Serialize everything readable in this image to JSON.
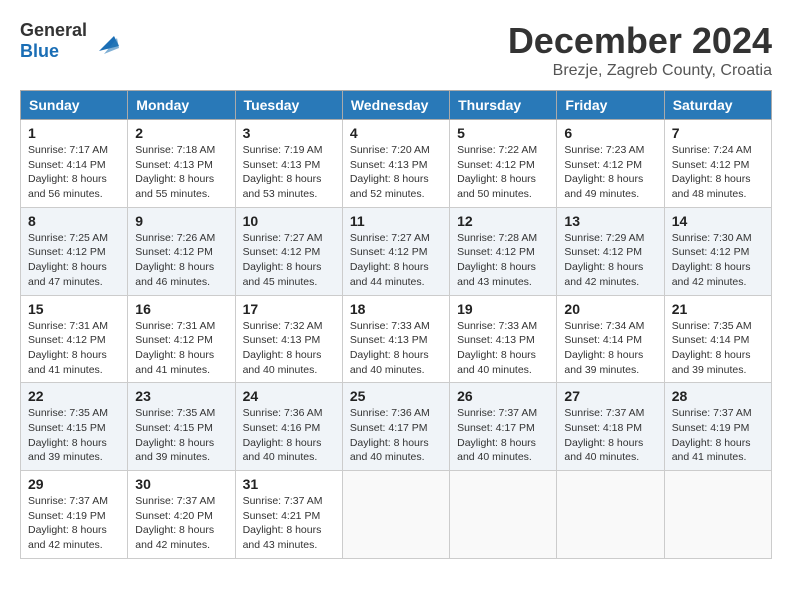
{
  "header": {
    "logo_general": "General",
    "logo_blue": "Blue",
    "month_title": "December 2024",
    "location": "Brezje, Zagreb County, Croatia"
  },
  "weekdays": [
    "Sunday",
    "Monday",
    "Tuesday",
    "Wednesday",
    "Thursday",
    "Friday",
    "Saturday"
  ],
  "days": [
    null,
    null,
    null,
    {
      "num": "1",
      "sunrise": "Sunrise: 7:17 AM",
      "sunset": "Sunset: 4:14 PM",
      "daylight": "Daylight: 8 hours and 56 minutes."
    },
    {
      "num": "2",
      "sunrise": "Sunrise: 7:18 AM",
      "sunset": "Sunset: 4:13 PM",
      "daylight": "Daylight: 8 hours and 55 minutes."
    },
    {
      "num": "3",
      "sunrise": "Sunrise: 7:19 AM",
      "sunset": "Sunset: 4:13 PM",
      "daylight": "Daylight: 8 hours and 53 minutes."
    },
    {
      "num": "4",
      "sunrise": "Sunrise: 7:20 AM",
      "sunset": "Sunset: 4:13 PM",
      "daylight": "Daylight: 8 hours and 52 minutes."
    },
    {
      "num": "5",
      "sunrise": "Sunrise: 7:22 AM",
      "sunset": "Sunset: 4:12 PM",
      "daylight": "Daylight: 8 hours and 50 minutes."
    },
    {
      "num": "6",
      "sunrise": "Sunrise: 7:23 AM",
      "sunset": "Sunset: 4:12 PM",
      "daylight": "Daylight: 8 hours and 49 minutes."
    },
    {
      "num": "7",
      "sunrise": "Sunrise: 7:24 AM",
      "sunset": "Sunset: 4:12 PM",
      "daylight": "Daylight: 8 hours and 48 minutes."
    },
    {
      "num": "8",
      "sunrise": "Sunrise: 7:25 AM",
      "sunset": "Sunset: 4:12 PM",
      "daylight": "Daylight: 8 hours and 47 minutes."
    },
    {
      "num": "9",
      "sunrise": "Sunrise: 7:26 AM",
      "sunset": "Sunset: 4:12 PM",
      "daylight": "Daylight: 8 hours and 46 minutes."
    },
    {
      "num": "10",
      "sunrise": "Sunrise: 7:27 AM",
      "sunset": "Sunset: 4:12 PM",
      "daylight": "Daylight: 8 hours and 45 minutes."
    },
    {
      "num": "11",
      "sunrise": "Sunrise: 7:27 AM",
      "sunset": "Sunset: 4:12 PM",
      "daylight": "Daylight: 8 hours and 44 minutes."
    },
    {
      "num": "12",
      "sunrise": "Sunrise: 7:28 AM",
      "sunset": "Sunset: 4:12 PM",
      "daylight": "Daylight: 8 hours and 43 minutes."
    },
    {
      "num": "13",
      "sunrise": "Sunrise: 7:29 AM",
      "sunset": "Sunset: 4:12 PM",
      "daylight": "Daylight: 8 hours and 42 minutes."
    },
    {
      "num": "14",
      "sunrise": "Sunrise: 7:30 AM",
      "sunset": "Sunset: 4:12 PM",
      "daylight": "Daylight: 8 hours and 42 minutes."
    },
    {
      "num": "15",
      "sunrise": "Sunrise: 7:31 AM",
      "sunset": "Sunset: 4:12 PM",
      "daylight": "Daylight: 8 hours and 41 minutes."
    },
    {
      "num": "16",
      "sunrise": "Sunrise: 7:31 AM",
      "sunset": "Sunset: 4:12 PM",
      "daylight": "Daylight: 8 hours and 41 minutes."
    },
    {
      "num": "17",
      "sunrise": "Sunrise: 7:32 AM",
      "sunset": "Sunset: 4:13 PM",
      "daylight": "Daylight: 8 hours and 40 minutes."
    },
    {
      "num": "18",
      "sunrise": "Sunrise: 7:33 AM",
      "sunset": "Sunset: 4:13 PM",
      "daylight": "Daylight: 8 hours and 40 minutes."
    },
    {
      "num": "19",
      "sunrise": "Sunrise: 7:33 AM",
      "sunset": "Sunset: 4:13 PM",
      "daylight": "Daylight: 8 hours and 40 minutes."
    },
    {
      "num": "20",
      "sunrise": "Sunrise: 7:34 AM",
      "sunset": "Sunset: 4:14 PM",
      "daylight": "Daylight: 8 hours and 39 minutes."
    },
    {
      "num": "21",
      "sunrise": "Sunrise: 7:35 AM",
      "sunset": "Sunset: 4:14 PM",
      "daylight": "Daylight: 8 hours and 39 minutes."
    },
    {
      "num": "22",
      "sunrise": "Sunrise: 7:35 AM",
      "sunset": "Sunset: 4:15 PM",
      "daylight": "Daylight: 8 hours and 39 minutes."
    },
    {
      "num": "23",
      "sunrise": "Sunrise: 7:35 AM",
      "sunset": "Sunset: 4:15 PM",
      "daylight": "Daylight: 8 hours and 39 minutes."
    },
    {
      "num": "24",
      "sunrise": "Sunrise: 7:36 AM",
      "sunset": "Sunset: 4:16 PM",
      "daylight": "Daylight: 8 hours and 40 minutes."
    },
    {
      "num": "25",
      "sunrise": "Sunrise: 7:36 AM",
      "sunset": "Sunset: 4:17 PM",
      "daylight": "Daylight: 8 hours and 40 minutes."
    },
    {
      "num": "26",
      "sunrise": "Sunrise: 7:37 AM",
      "sunset": "Sunset: 4:17 PM",
      "daylight": "Daylight: 8 hours and 40 minutes."
    },
    {
      "num": "27",
      "sunrise": "Sunrise: 7:37 AM",
      "sunset": "Sunset: 4:18 PM",
      "daylight": "Daylight: 8 hours and 40 minutes."
    },
    {
      "num": "28",
      "sunrise": "Sunrise: 7:37 AM",
      "sunset": "Sunset: 4:19 PM",
      "daylight": "Daylight: 8 hours and 41 minutes."
    },
    {
      "num": "29",
      "sunrise": "Sunrise: 7:37 AM",
      "sunset": "Sunset: 4:19 PM",
      "daylight": "Daylight: 8 hours and 42 minutes."
    },
    {
      "num": "30",
      "sunrise": "Sunrise: 7:37 AM",
      "sunset": "Sunset: 4:20 PM",
      "daylight": "Daylight: 8 hours and 42 minutes."
    },
    {
      "num": "31",
      "sunrise": "Sunrise: 7:37 AM",
      "sunset": "Sunset: 4:21 PM",
      "daylight": "Daylight: 8 hours and 43 minutes."
    }
  ]
}
